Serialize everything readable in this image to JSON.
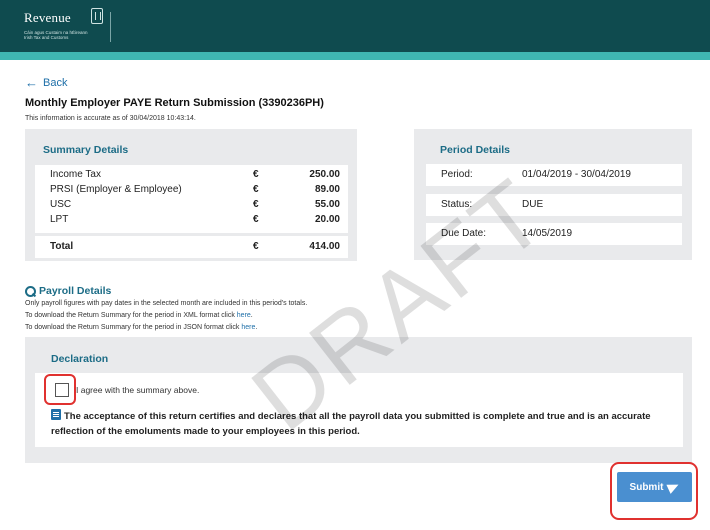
{
  "header": {
    "logo_name": "Revenue",
    "logo_sub": "Cáin agus Custaim na hÉireann Irish Tax and Customs"
  },
  "nav": {
    "back_label": "Back"
  },
  "page": {
    "title": "Monthly Employer PAYE Return Submission (3390236PH)",
    "accuracy_note": "This information is accurate as of 30/04/2018 10:43:14."
  },
  "summary": {
    "title": "Summary Details",
    "rows": [
      {
        "label": "Income Tax",
        "currency": "€",
        "amount": "250.00"
      },
      {
        "label": "PRSI (Employer & Employee)",
        "currency": "€",
        "amount": "89.00"
      },
      {
        "label": "USC",
        "currency": "€",
        "amount": "55.00"
      },
      {
        "label": "LPT",
        "currency": "€",
        "amount": "20.00"
      }
    ],
    "total": {
      "label": "Total",
      "currency": "€",
      "amount": "414.00"
    }
  },
  "period": {
    "title": "Period Details",
    "rows": [
      {
        "label": "Period:",
        "value": "01/04/2019 - 30/04/2019"
      },
      {
        "label": "Status:",
        "value": "DUE"
      },
      {
        "label": "Due Date:",
        "value": "14/05/2019"
      }
    ]
  },
  "payroll": {
    "title": "Payroll Details",
    "line1": "Only payroll figures with pay dates in the selected month are included in this period's totals.",
    "line2_prefix": "To download the Return Summary for the period in XML format click ",
    "line3_prefix": "To download the Return Summary for the period in JSON format click ",
    "link_text": "here",
    "link_suffix": "."
  },
  "declaration": {
    "title": "Declaration",
    "agree_label": "I agree with the summary above.",
    "statement": "The acceptance of this return certifies and declares that all the payroll data you submitted is complete and true and is an accurate reflection of the emoluments made to your employees in this period."
  },
  "actions": {
    "submit_label": "Submit"
  },
  "watermark": "DRAFT",
  "colors": {
    "header": "#0f4b4f",
    "header_strip": "#3fb6b2",
    "panel_title": "#1c6c86",
    "link": "#1e6fa8",
    "submit": "#4a8fd0",
    "highlight": "#e0312f"
  }
}
